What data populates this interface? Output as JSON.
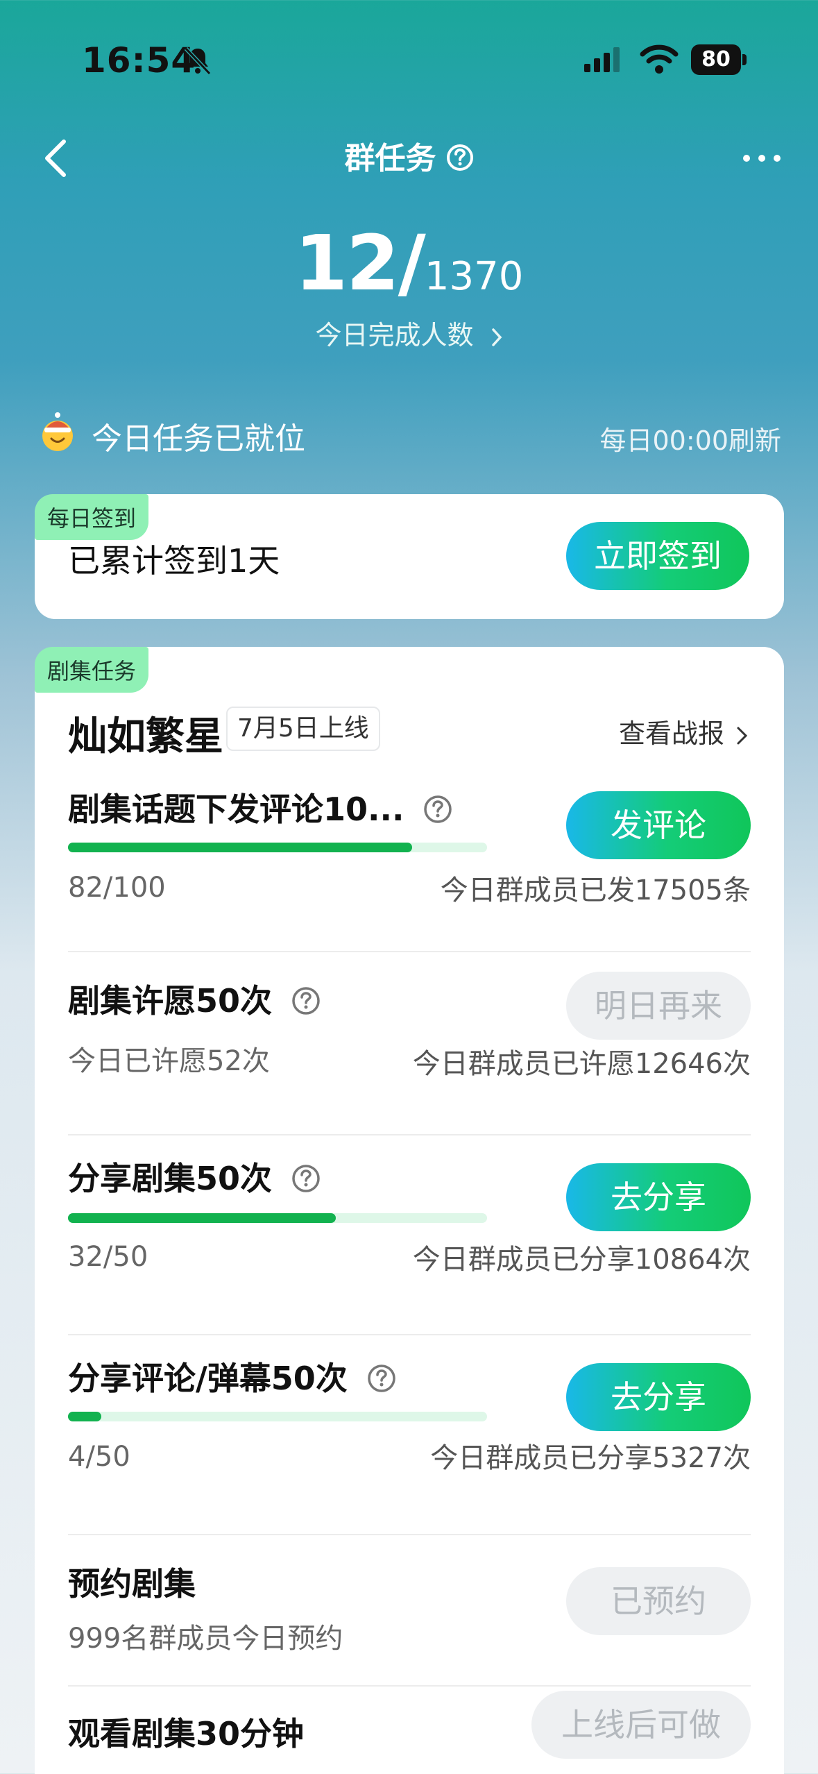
{
  "status_bar": {
    "time": "16:54",
    "battery": "80"
  },
  "nav": {
    "title": "群任务"
  },
  "stats": {
    "completed": "12/",
    "total": "1370",
    "caption": "今日完成人数"
  },
  "ready": {
    "text": "今日任务已就位",
    "refresh": "每日00:00刷新"
  },
  "signin": {
    "tag": "每日签到",
    "text": "已累计签到1天",
    "button": "立即签到"
  },
  "drama": {
    "tag": "剧集任务",
    "title": "灿如繁星",
    "date": "7月5日上线",
    "report": "查看战报",
    "tasks": [
      {
        "title": "剧集话题下发评论10...",
        "count": "82/100",
        "progress": 0.82,
        "stat": "今日群成员已发17505条",
        "button": "发评论",
        "enabled": true
      },
      {
        "title": "剧集许愿50次",
        "count": "今日已许愿52次",
        "stat": "今日群成员已许愿12646次",
        "button": "明日再来",
        "enabled": false
      },
      {
        "title": "分享剧集50次",
        "count": "32/50",
        "progress": 0.64,
        "stat": "今日群成员已分享10864次",
        "button": "去分享",
        "enabled": true
      },
      {
        "title": "分享评论/弹幕50次",
        "count": "4/50",
        "progress": 0.08,
        "stat": "今日群成员已分享5327次",
        "button": "去分享",
        "enabled": true
      },
      {
        "title": "预约剧集",
        "count": "999名群成员今日预约",
        "button": "已预约",
        "enabled": false
      },
      {
        "title": "观看剧集30分钟",
        "button": "上线后可做",
        "enabled": false
      }
    ]
  },
  "colors": {
    "accent_green": "#12b24f",
    "button_gradient_start": "#19b8e8",
    "button_gradient_end": "#10c65a",
    "tag_bg": "#8ff0b5"
  }
}
